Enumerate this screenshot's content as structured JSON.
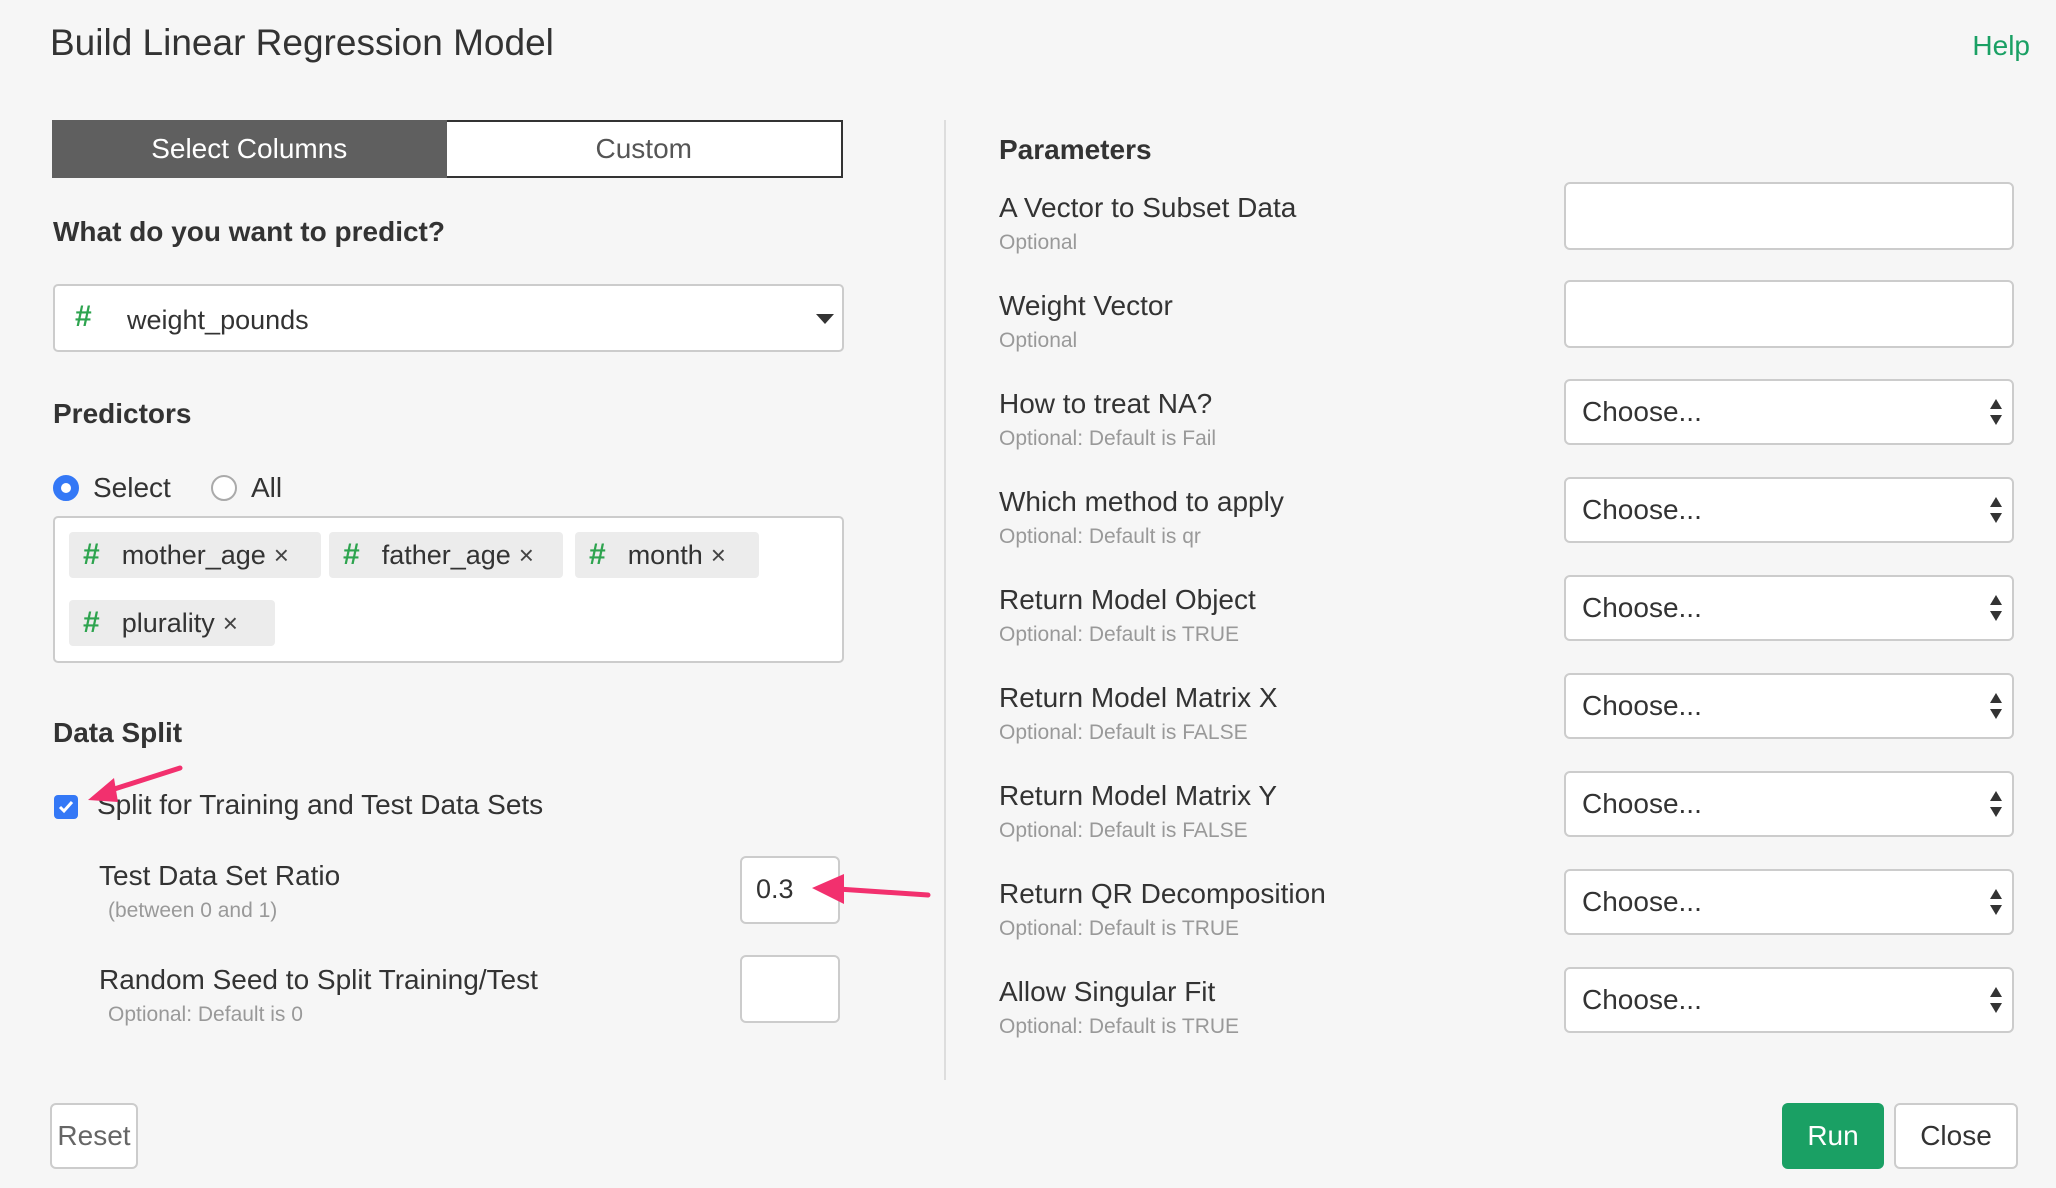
{
  "dialog": {
    "title": "Build Linear Regression Model",
    "help_label": "Help"
  },
  "tabs": [
    {
      "label": "Select Columns",
      "active": true
    },
    {
      "label": "Custom",
      "active": false
    }
  ],
  "predict": {
    "question": "What do you want to predict?",
    "selected": "weight_pounds",
    "type_icon": "hash-icon"
  },
  "predictors": {
    "title": "Predictors",
    "mode_options": [
      {
        "label": "Select",
        "checked": true
      },
      {
        "label": "All",
        "checked": false
      }
    ],
    "tags": [
      "mother_age",
      "father_age",
      "month",
      "plurality"
    ],
    "remove_glyph": "×"
  },
  "data_split": {
    "title": "Data Split",
    "checkbox_label": "Split for Training and Test Data Sets",
    "checked": true,
    "ratio_label": "Test Data Set Ratio",
    "ratio_sub": "(between 0 and 1)",
    "ratio_value": "0.3",
    "seed_label": "Random Seed to Split Training/Test",
    "seed_sub": "Optional: Default is 0",
    "seed_value": ""
  },
  "parameters": {
    "title": "Parameters",
    "items": [
      {
        "label": "A Vector to Subset Data",
        "sub": "Optional",
        "kind": "text",
        "value": ""
      },
      {
        "label": "Weight Vector",
        "sub": "Optional",
        "kind": "text",
        "value": ""
      },
      {
        "label": "How to treat NA?",
        "sub": "Optional: Default is Fail",
        "kind": "select",
        "value": "Choose..."
      },
      {
        "label": "Which method to apply",
        "sub": "Optional: Default is qr",
        "kind": "select",
        "value": "Choose..."
      },
      {
        "label": "Return Model Object",
        "sub": "Optional: Default is TRUE",
        "kind": "select",
        "value": "Choose..."
      },
      {
        "label": "Return Model Matrix X",
        "sub": "Optional: Default is FALSE",
        "kind": "select",
        "value": "Choose..."
      },
      {
        "label": "Return Model Matrix Y",
        "sub": "Optional: Default is FALSE",
        "kind": "select",
        "value": "Choose..."
      },
      {
        "label": "Return QR Decomposition",
        "sub": "Optional: Default is TRUE",
        "kind": "select",
        "value": "Choose..."
      },
      {
        "label": "Allow Singular Fit",
        "sub": "Optional: Default is TRUE",
        "kind": "select",
        "value": "Choose..."
      }
    ]
  },
  "footer": {
    "reset_label": "Reset",
    "run_label": "Run",
    "close_label": "Close"
  },
  "colors": {
    "accent_green": "#1aa064",
    "hash_green": "#2ea44f",
    "annotation_pink": "#f2306e",
    "checkbox_blue": "#3478f6"
  }
}
